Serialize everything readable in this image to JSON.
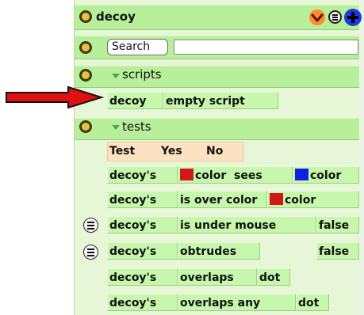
{
  "header": {
    "title": "decoy"
  },
  "search": {
    "button_label": "Search",
    "input_value": ""
  },
  "scripts_section": {
    "label": "scripts",
    "tile": {
      "object": "decoy",
      "name": "empty script"
    }
  },
  "tests_section": {
    "label": "tests",
    "header_row": {
      "test": "Test",
      "yes": "Yes",
      "no": "No"
    },
    "rows": [
      {
        "object": "decoy's",
        "text1": "color",
        "color1": "#d11717",
        "text2": "sees",
        "color2": "#1020e0",
        "text3": "color"
      },
      {
        "object": "decoy's",
        "text1": "is over color",
        "color1": "#d11717",
        "text3": "color"
      },
      {
        "object": "decoy's",
        "text1": "is under mouse",
        "result": "false"
      },
      {
        "object": "decoy's",
        "text1": "obtrudes",
        "result": "false"
      },
      {
        "object": "decoy's",
        "text1": "overlaps",
        "text2": "dot"
      },
      {
        "object": "decoy's",
        "text1": "overlaps any",
        "text2": "dot"
      }
    ]
  },
  "colors": {
    "panel_bg": "#e6f6d7",
    "header_bg": "#b8ef9a",
    "tile_bg": "#c6f7ac",
    "arrow": "#e01010",
    "add_button": "#1d39e6",
    "collapse_button": "#ff8c2e"
  },
  "icons": [
    "collapse-icon",
    "menu-icon",
    "add-icon",
    "triangle-down-icon",
    "arrow-right-icon",
    "halo-handle-icon"
  ]
}
